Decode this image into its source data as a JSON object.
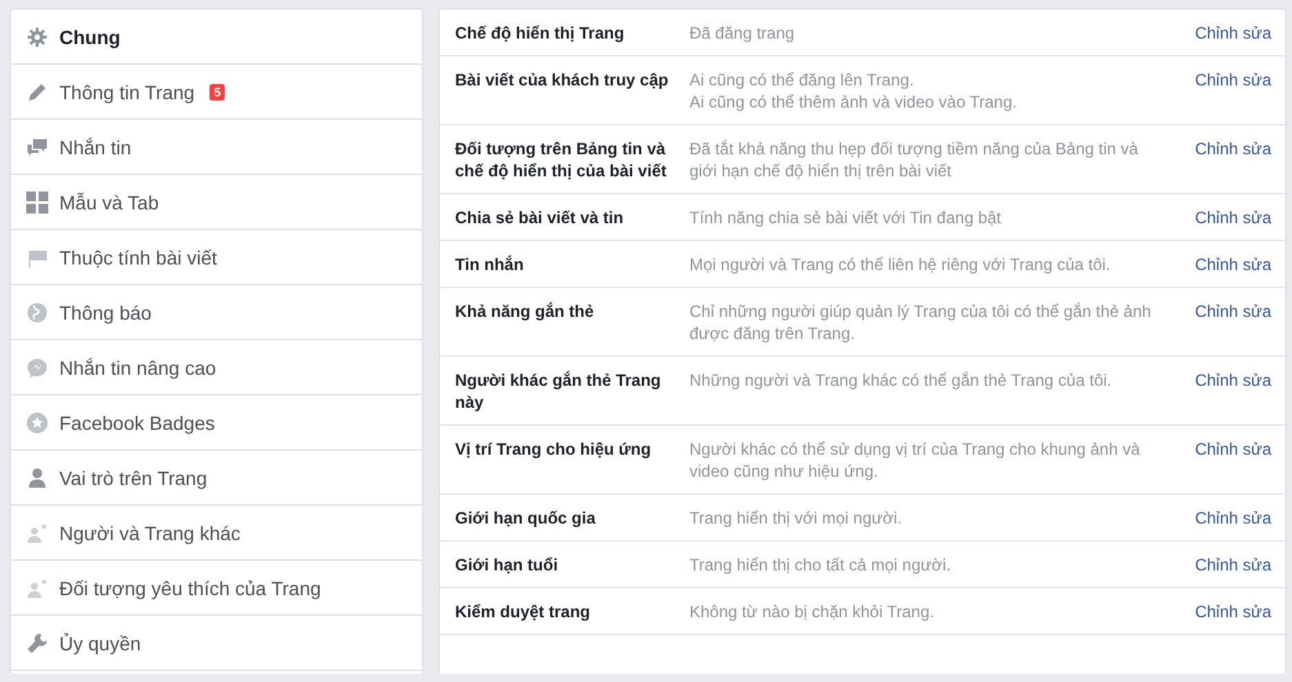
{
  "sidebar": {
    "items": [
      {
        "label": "Chung",
        "kind": "gear",
        "selected": true
      },
      {
        "label": "Thông tin Trang",
        "kind": "pencil",
        "selected": false,
        "badge": "5"
      },
      {
        "label": "Nhắn tin",
        "kind": "chats",
        "selected": false
      },
      {
        "label": "Mẫu và Tab",
        "kind": "grid",
        "selected": false
      },
      {
        "label": "Thuộc tính bài viết",
        "kind": "flag",
        "selected": false
      },
      {
        "label": "Thông báo",
        "kind": "globe",
        "selected": false
      },
      {
        "label": "Nhắn tin nâng cao",
        "kind": "bubble",
        "selected": false
      },
      {
        "label": "Facebook Badges",
        "kind": "star",
        "selected": false
      },
      {
        "label": "Vai trò trên Trang",
        "kind": "person",
        "selected": false
      },
      {
        "label": "Người và Trang khác",
        "kind": "personstar",
        "selected": false
      },
      {
        "label": "Đối tượng yêu thích của Trang",
        "kind": "personstar",
        "selected": false
      },
      {
        "label": "Ủy quyền",
        "kind": "wrench",
        "selected": false
      }
    ]
  },
  "settings": {
    "rows": [
      {
        "title": [
          "Chế độ hiển thị Trang"
        ],
        "value": [
          "Đã đăng trang"
        ],
        "action": "Chỉnh sửa"
      },
      {
        "title": [
          "Bài viết của khách truy cập"
        ],
        "value": [
          "Ai cũng có thể đăng lên Trang.",
          "Ai cũng có thể thêm ảnh và video vào Trang."
        ],
        "action": "Chỉnh sửa"
      },
      {
        "title": [
          "Đối tượng trên Bảng tin và",
          "chế độ hiển thị của bài viết"
        ],
        "value": [
          "Đã tắt khả năng thu hẹp đối tượng tiềm năng của Bảng tin và",
          "giới hạn chế độ hiển thị trên bài viết"
        ],
        "action": "Chỉnh sửa"
      },
      {
        "title": [
          "Chia sẻ bài viết và tin"
        ],
        "value": [
          "Tính năng chia sẻ bài viết với Tin đang bật"
        ],
        "action": "Chỉnh sửa"
      },
      {
        "title": [
          "Tin nhắn"
        ],
        "value": [
          "Mọi người và Trang có thể liên hệ riêng với Trang của tôi."
        ],
        "action": "Chỉnh sửa"
      },
      {
        "title": [
          "Khả năng gắn thẻ"
        ],
        "value": [
          "Chỉ những người giúp quản lý Trang của tôi có thể gắn thẻ ảnh",
          "được đăng trên Trang."
        ],
        "action": "Chỉnh sửa"
      },
      {
        "title": [
          "Người khác gắn thẻ Trang",
          "này"
        ],
        "value": [
          "Những người và Trang khác có thể gắn thẻ Trang của tôi."
        ],
        "action": "Chỉnh sửa"
      },
      {
        "title": [
          "Vị trí Trang cho hiệu ứng"
        ],
        "value": [
          "Người khác có thể sử dụng vị trí của Trang cho khung ảnh và",
          "video cũng như hiệu ứng."
        ],
        "action": "Chỉnh sửa"
      },
      {
        "title": [
          "Giới hạn quốc gia"
        ],
        "value": [
          "Trang hiển thị với mọi người."
        ],
        "action": "Chỉnh sửa"
      },
      {
        "title": [
          "Giới hạn tuổi"
        ],
        "value": [
          "Trang hiển thị cho tất cả mọi người."
        ],
        "action": "Chỉnh sửa"
      },
      {
        "title": [
          "Kiểm duyệt trang"
        ],
        "value": [
          "Không từ nào bị chặn khỏi Trang."
        ],
        "action": "Chỉnh sửa"
      }
    ]
  }
}
